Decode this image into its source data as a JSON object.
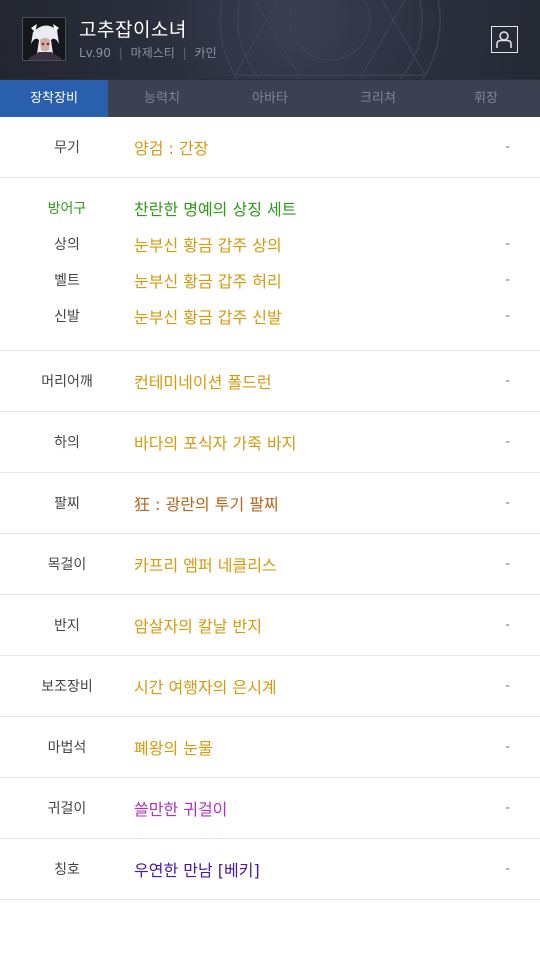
{
  "header": {
    "character_name": "고추잡이소녀",
    "level": "Lv.90",
    "job": "마제스티",
    "server": "카인",
    "separator": "|"
  },
  "tabs": [
    {
      "label": "장착장비",
      "active": true
    },
    {
      "label": "능력치",
      "active": false
    },
    {
      "label": "아바타",
      "active": false
    },
    {
      "label": "크리쳐",
      "active": false
    },
    {
      "label": "휘장",
      "active": false
    }
  ],
  "colors": {
    "unique": "#d49a0c",
    "set": "#2e9a1a",
    "epic": "#b8651a",
    "rare": "#b22fc2",
    "legendary": "#4a16a8",
    "tab_active": "#2a5fae"
  },
  "equipment": {
    "weapon": {
      "slot": "무기",
      "name": "양검 : 간장",
      "value": "-"
    },
    "armor_set": {
      "slot": "방어구",
      "name": "찬란한 명예의 상징 세트"
    },
    "top": {
      "slot": "상의",
      "name": "눈부신 황금 갑주 상의",
      "value": "-"
    },
    "belt": {
      "slot": "벨트",
      "name": "눈부신 황금 갑주 허리",
      "value": "-"
    },
    "shoes": {
      "slot": "신발",
      "name": "눈부신 황금 갑주 신발",
      "value": "-"
    },
    "shoulder": {
      "slot": "머리어깨",
      "name": "컨테미네이션 폴드런",
      "value": "-"
    },
    "bottom": {
      "slot": "하의",
      "name": "바다의 포식자 가죽 바지",
      "value": "-"
    },
    "bracelet": {
      "slot": "팔찌",
      "name": "狂 : 광란의 투기 팔찌",
      "value": "-"
    },
    "necklace": {
      "slot": "목걸이",
      "name": "카프리 엠퍼 네클리스",
      "value": "-"
    },
    "ring": {
      "slot": "반지",
      "name": "암살자의 칼날 반지",
      "value": "-"
    },
    "support": {
      "slot": "보조장비",
      "name": "시간 여행자의 은시계",
      "value": "-"
    },
    "magic_stone": {
      "slot": "마법석",
      "name": "폐왕의 눈물",
      "value": "-"
    },
    "earring": {
      "slot": "귀걸이",
      "name": "쓸만한 귀걸이",
      "value": "-"
    },
    "title": {
      "slot": "칭호",
      "name": "우연한 만남 [베키]",
      "value": "-"
    }
  }
}
